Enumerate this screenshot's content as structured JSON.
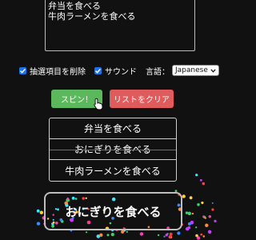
{
  "textarea": {
    "value": "弁当を食べる\n牛肉ラーメンを食べる"
  },
  "options": {
    "remove_label": "抽選項目を削除",
    "remove_checked": true,
    "sound_label": "サウンド",
    "sound_checked": true,
    "language_label": "言語：",
    "language_value": "Japanese"
  },
  "buttons": {
    "spin_label": "スピン！",
    "clear_label": "リストをクリア"
  },
  "list": {
    "items": [
      {
        "label": "弁当を食べる",
        "removed": false
      },
      {
        "label": "おにぎりを食べる",
        "removed": true
      },
      {
        "label": "牛肉ラーメンを食べる",
        "removed": false
      }
    ]
  },
  "result": {
    "label": "おにぎりを食べる"
  },
  "colors": {
    "background": "#111111",
    "spin_button": "#5cb85c",
    "clear_button": "#e05c5c",
    "checkbox": "#1a73e8",
    "strike": "#e53935"
  },
  "icons": [
    "checkbox-icon",
    "chevron-down-icon",
    "pointer-cursor-icon"
  ]
}
